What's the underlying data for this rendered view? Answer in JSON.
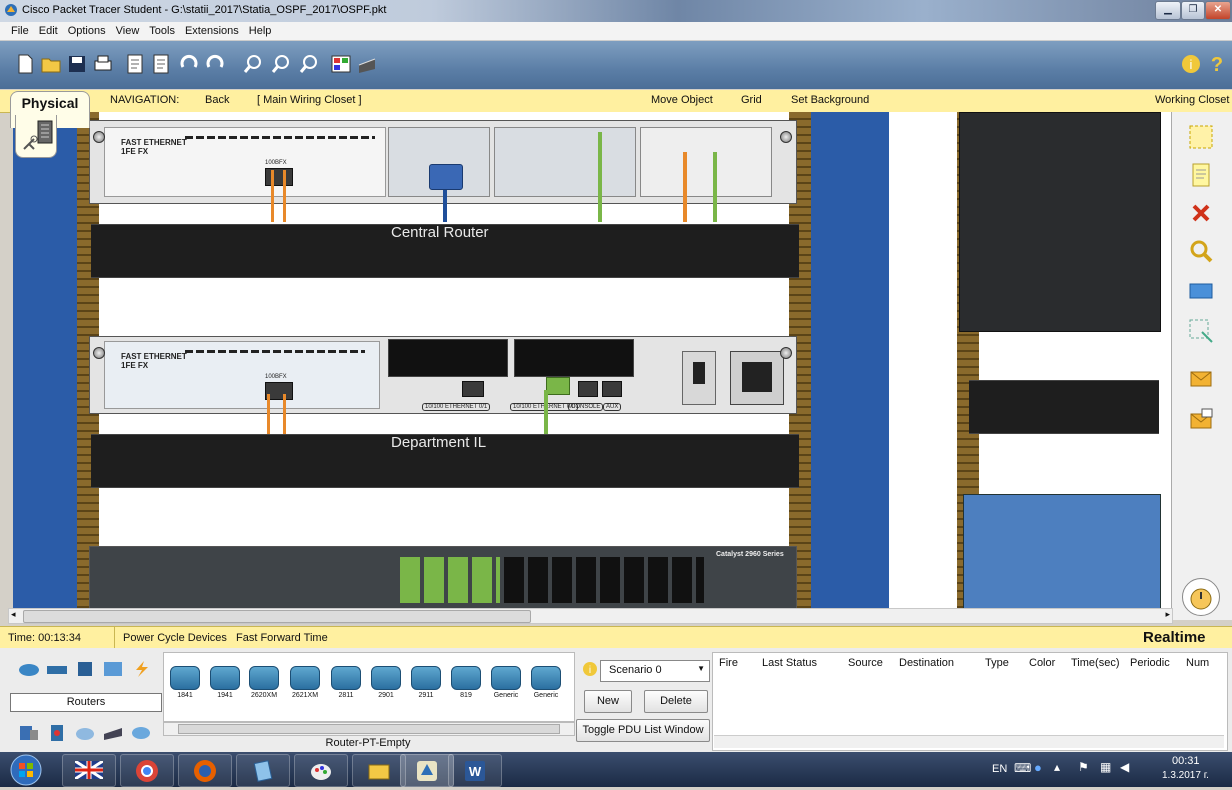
{
  "window": {
    "title": "Cisco Packet Tracer Student - G:\\statii_2017\\Statia_OSPF_2017\\OSPF.pkt",
    "controls": [
      "minimize-icon",
      "maximize-icon",
      "close-icon"
    ]
  },
  "menu": [
    "File",
    "Edit",
    "Options",
    "View",
    "Tools",
    "Extensions",
    "Help"
  ],
  "toolbar": {
    "left_icons": [
      "new-file-icon",
      "open-folder-icon",
      "save-icon",
      "print-icon",
      "activity-wizard-icon",
      "activity-wizard-icon",
      "undo-icon",
      "redo-icon",
      "zoom-in-icon",
      "zoom-reset-icon",
      "zoom-out-icon",
      "drawing-palette-icon",
      "custom-device-icon"
    ],
    "right_icons": [
      "info-icon",
      "help-icon"
    ]
  },
  "nav": {
    "physical_tab": "Physical",
    "navigation_label": "NAVIGATION:",
    "back": "Back",
    "location": "[ Main Wiring Closet ]",
    "move_object": "Move Object",
    "grid": "Grid",
    "set_background": "Set Background",
    "working_closet": "Working Closet"
  },
  "workspace": {
    "devices": [
      {
        "label": "Central Router",
        "module_labels": [
          "FAST ETHERNET",
          "1FE FX",
          "100BFX"
        ]
      },
      {
        "label": "Department IL",
        "module_labels": [
          "FAST ETHERNET",
          "1FE FX",
          "100BFX",
          "10/100 ETHERNET 0/1",
          "10/100 ETHERNET 0/0",
          "CONSOLE",
          "AUX"
        ]
      }
    ],
    "switch_label": "Catalyst 2960 Series",
    "colors": {
      "rack_blue": "#2b5ca8",
      "rail_brown": "#8a6a2c",
      "cable_orange": "#e8892a",
      "cable_green": "#7ab648",
      "cable_blue": "#1f4f9a"
    }
  },
  "palette_icons": [
    "select-icon",
    "note-icon",
    "delete-icon",
    "inspect-icon",
    "draw-shape-icon",
    "resize-icon",
    "add-simple-pdu-icon",
    "add-complex-pdu-icon"
  ],
  "statusbar": {
    "time": "Time: 00:13:34",
    "power_cycle": "Power Cycle Devices",
    "fast_forward": "Fast Forward Time",
    "mode": "Realtime"
  },
  "device_panel": {
    "category": "Routers",
    "models": [
      "1841",
      "1941",
      "2620XM",
      "2621XM",
      "2811",
      "2901",
      "2911",
      "819",
      "Generic",
      "Generic"
    ],
    "selected_model": "Router-PT-Empty"
  },
  "scenario": {
    "selected": "Scenario 0",
    "new": "New",
    "delete": "Delete",
    "toggle": "Toggle PDU List Window"
  },
  "pdu_columns": [
    "Fire",
    "Last Status",
    "Source",
    "Destination",
    "Type",
    "Color",
    "Time(sec)",
    "Periodic",
    "Num"
  ],
  "taskbar": {
    "apps": [
      "start-icon",
      "language-flag-icon",
      "chrome-icon",
      "firefox-icon",
      "documents-icon",
      "paint-icon",
      "file-explorer-icon",
      "packet-tracer-icon",
      "word-icon"
    ],
    "lang": "EN",
    "clock_time": "00:31",
    "clock_date": "1.3.2017 г."
  }
}
